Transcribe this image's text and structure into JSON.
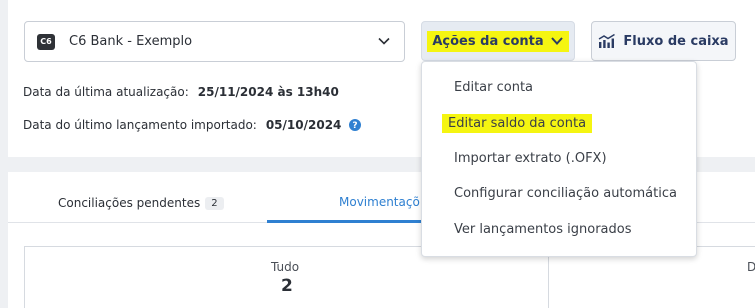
{
  "account": {
    "logo_text": "C6",
    "name": "C6 Bank - Exemplo"
  },
  "toolbar": {
    "actions_label": "Ações da conta",
    "cashflow_label": "Fluxo de caixa"
  },
  "info": {
    "last_update_label": "Data da última atualização:",
    "last_update_value": "25/11/2024 às 13h40",
    "last_import_label": "Data do último lançamento importado:",
    "last_import_value": "05/10/2024"
  },
  "tabs": {
    "pending_label": "Conciliações pendentes",
    "pending_count": "2",
    "movements_label": "Movimentaçõ"
  },
  "stats": {
    "all_label": "Tudo",
    "all_value": "2",
    "next_label_partial": "D"
  },
  "menu": {
    "items": [
      "Editar conta",
      "Editar saldo da conta",
      "Importar extrato (.OFX)",
      "Configurar conciliação automática",
      "Ver lançamentos ignorados"
    ]
  },
  "colors": {
    "highlight": "#f5f511",
    "accent_blue": "#2f80d1",
    "navy": "#2a3b63"
  }
}
